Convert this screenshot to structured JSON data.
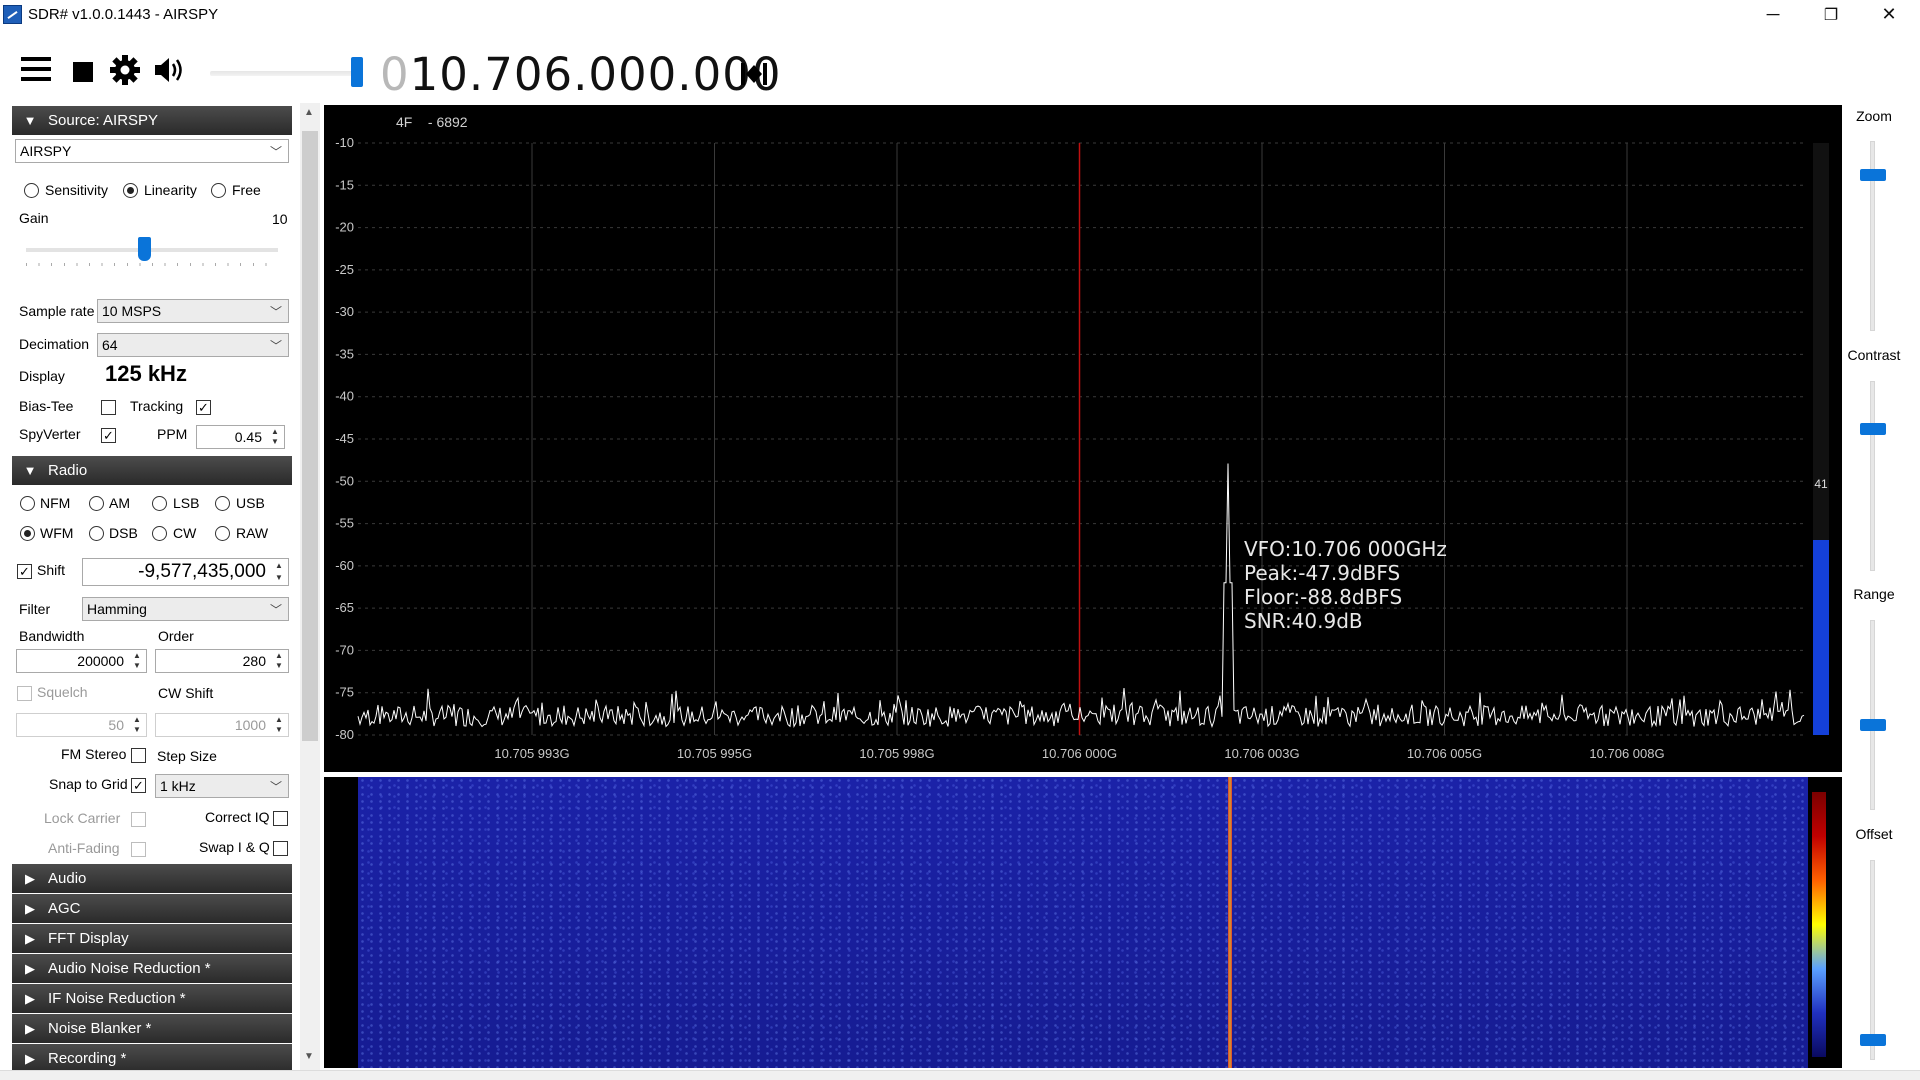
{
  "window": {
    "title": "SDR# v1.0.0.1443 - AIRSPY",
    "minimize_glyph": "─",
    "maximize_glyph": "❐",
    "close_glyph": "✕"
  },
  "toolbar": {
    "frequency_leading": "0",
    "frequency": "10.706.000.000",
    "icons": [
      "menu-icon",
      "stop-icon",
      "gear-icon",
      "speaker-icon",
      "tune-center-icon"
    ],
    "volume_level": 0.97
  },
  "source": {
    "header": "Source: AIRSPY",
    "device": "AIRSPY",
    "modes": [
      "Sensitivity",
      "Linearity",
      "Free"
    ],
    "selected_mode": "Linearity",
    "gain_label": "Gain",
    "gain_value": "10",
    "gain_fraction": 0.47,
    "sample_rate_label": "Sample rate",
    "sample_rate": "10 MSPS",
    "decimation_label": "Decimation",
    "decimation": "64",
    "display_label": "Display",
    "display_value": "125 kHz",
    "bias_tee_label": "Bias-Tee",
    "tracking_label": "Tracking",
    "spyverter_label": "SpyVerter",
    "ppm_label": "PPM",
    "ppm_value": "0.45",
    "check_glyph": "✓"
  },
  "radio": {
    "header": "Radio",
    "modes_row1": [
      "NFM",
      "AM",
      "LSB",
      "USB"
    ],
    "modes_row2": [
      "WFM",
      "DSB",
      "CW",
      "RAW"
    ],
    "selected_mode": "WFM",
    "shift_label": "Shift",
    "shift_value": "-9,577,435,000",
    "filter_label": "Filter",
    "filter_value": "Hamming",
    "bandwidth_label": "Bandwidth",
    "bandwidth_value": "200000",
    "order_label": "Order",
    "order_value": "280",
    "squelch_label": "Squelch",
    "squelch_value": "50",
    "cw_shift_label": "CW Shift",
    "cw_shift_value": "1000",
    "fm_stereo_label": "FM Stereo",
    "step_size_label": "Step Size",
    "snap_to_grid_label": "Snap to Grid",
    "step_size_value": "1 kHz",
    "lock_carrier_label": "Lock Carrier",
    "correct_iq_label": "Correct IQ",
    "anti_fading_label": "Anti-Fading",
    "swap_iq_label": "Swap I & Q"
  },
  "collapsed_sections": [
    "Audio",
    "AGC",
    "FFT Display",
    "Audio Noise Reduction *",
    "IF Noise Reduction *",
    "Noise Blanker *",
    "Recording *"
  ],
  "spectrum": {
    "header": "4F    - 6892",
    "y_ticks": [
      "-10",
      "-15",
      "-20",
      "-25",
      "-30",
      "-35",
      "-40",
      "-45",
      "-50",
      "-55",
      "-60",
      "-65",
      "-70",
      "-75",
      "-80"
    ],
    "x_ticks": [
      "10.705 993G",
      "10.705 995G",
      "10.705 998G",
      "10.706 000G",
      "10.706 003G",
      "10.706 005G",
      "10.706 008G"
    ],
    "info": {
      "vfo": "VFO:10.706 000GHz",
      "peak": "Peak:-47.9dBFS",
      "floor": "Floor:-88.8dBFS",
      "snr": "SNR:40.9dB"
    },
    "level_value": "41",
    "level_fraction": 0.33,
    "colors": {
      "center_line": "#c01010",
      "trace": "#ffffff",
      "grid": "#3a3a3a"
    }
  },
  "right_sliders": {
    "zoom_label": "Zoom",
    "contrast_label": "Contrast",
    "range_label": "Range",
    "offset_label": "Offset",
    "zoom_level": 0.25,
    "contrast_level": 0.25,
    "range_level": 0.45,
    "offset_level": 0.1
  }
}
